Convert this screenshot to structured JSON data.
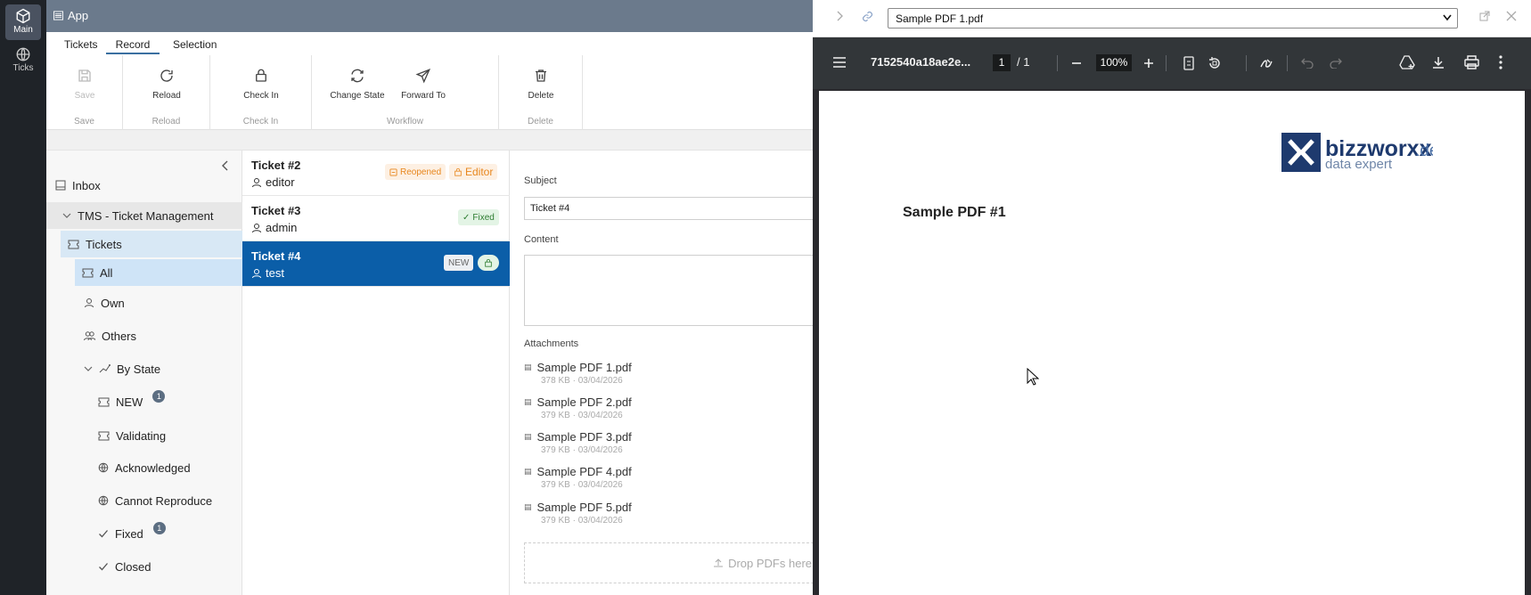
{
  "rail": {
    "main_label": "Main",
    "ticks_label": "Ticks"
  },
  "app": {
    "title": "App"
  },
  "tabs": [
    "Tickets",
    "Record",
    "Selection"
  ],
  "ribbon": {
    "save": "Save",
    "save_group": "Save",
    "reload": "Reload",
    "reload_group": "Reload",
    "checkin": "Check In",
    "checkin_group": "Check In",
    "change_state": "Change State",
    "forward_to": "Forward To",
    "workflow_group": "Workflow",
    "delete": "Delete",
    "delete_group": "Delete"
  },
  "nav": {
    "inbox": "Inbox",
    "tms": "TMS - Ticket Management",
    "tickets": "Tickets",
    "all": "All",
    "own": "Own",
    "others": "Others",
    "by_state": "By State",
    "new": "NEW",
    "new_count": "1",
    "validating": "Validating",
    "acknowledged": "Acknowledged",
    "cannot_reproduce": "Cannot Reproduce",
    "fixed": "Fixed",
    "fixed_count": "1",
    "closed": "Closed"
  },
  "tickets": [
    {
      "title": "Ticket #2",
      "user": "editor",
      "tag1": "Reopened",
      "tag2": "Editor"
    },
    {
      "title": "Ticket #3",
      "user": "admin",
      "tag1": "Fixed"
    },
    {
      "title": "Ticket #4",
      "user": "test",
      "tag1": "NEW"
    }
  ],
  "detail": {
    "subject_label": "Subject",
    "subject_value": "Ticket #4",
    "content_label": "Content",
    "attachments_label": "Attachments",
    "attachments": [
      {
        "name": "Sample PDF 1.pdf",
        "meta": "378 KB · 03/04/2026"
      },
      {
        "name": "Sample PDF 2.pdf",
        "meta": "379 KB · 03/04/2026"
      },
      {
        "name": "Sample PDF 3.pdf",
        "meta": "379 KB · 03/04/2026"
      },
      {
        "name": "Sample PDF 4.pdf",
        "meta": "379 KB · 03/04/2026"
      },
      {
        "name": "Sample PDF 5.pdf",
        "meta": "379 KB · 03/04/2026"
      }
    ],
    "drop_text": "Drop PDFs here"
  },
  "viewer": {
    "file_select": "Sample PDF 1.pdf",
    "doc_id": "7152540a18ae2e...",
    "page_current": "1",
    "page_total": "/  1",
    "zoom": "100%",
    "logo_brand": "bizzworxx",
    "logo_tld": ".de",
    "logo_tagline": "data expert",
    "heading": "Sample PDF #1"
  },
  "colors": {
    "accent": "#0b5ea8",
    "header": "#6b7a8c",
    "rail": "#1f2328",
    "viewer_bar": "#323639",
    "logo": "#1e3a6e"
  }
}
